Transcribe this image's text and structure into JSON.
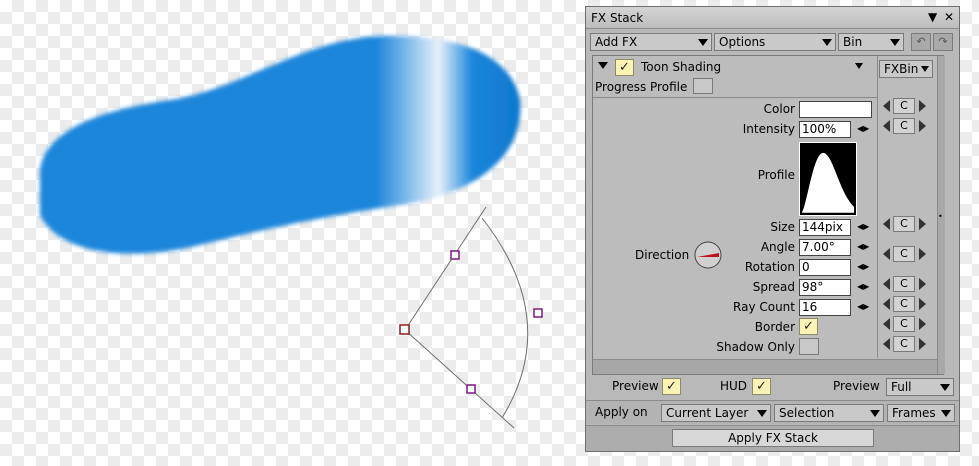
{
  "colors": {
    "stroke_blue": "#1b86db",
    "panel_bg": "#b9b9b9",
    "check_bg": "#fbf3b4",
    "dial_red": "#c0141c",
    "handle_purple": "#7a1b7d",
    "handle_red": "#8c1b1b"
  },
  "panel": {
    "title": "FX Stack",
    "icons": {
      "collapse": "triangle-down-icon",
      "close": "close-icon"
    },
    "toolbar": {
      "add_fx": "Add FX",
      "options": "Options",
      "bin": "Bin",
      "undo_icon": "undo-icon",
      "redo_icon": "redo-icon"
    },
    "effect": {
      "name": "Toon Shading",
      "bin_button": "FXBin",
      "progress_profile_label": "Progress Profile",
      "params": {
        "color_label": "Color",
        "intensity_label": "Intensity",
        "intensity_value": "100%",
        "profile_label": "Profile",
        "size_label": "Size",
        "size_value": "144pix",
        "direction_label": "Direction",
        "angle_label": "Angle",
        "angle_value": "7.00°",
        "rotation_label": "Rotation",
        "rotation_value": "0",
        "spread_label": "Spread",
        "spread_value": "98°",
        "ray_count_label": "Ray Count",
        "ray_count_value": "16",
        "border_label": "Border",
        "shadow_only_label": "Shadow Only"
      },
      "c_label": "C"
    },
    "footer": {
      "preview_label": "Preview",
      "hud_label": "HUD",
      "preview_mode_label": "Preview",
      "preview_mode_value": "Full",
      "apply_on_label": "Apply on",
      "layer_value": "Current Layer",
      "selection_value": "Selection",
      "frames_value": "Frames",
      "apply_button": "Apply FX Stack"
    }
  }
}
